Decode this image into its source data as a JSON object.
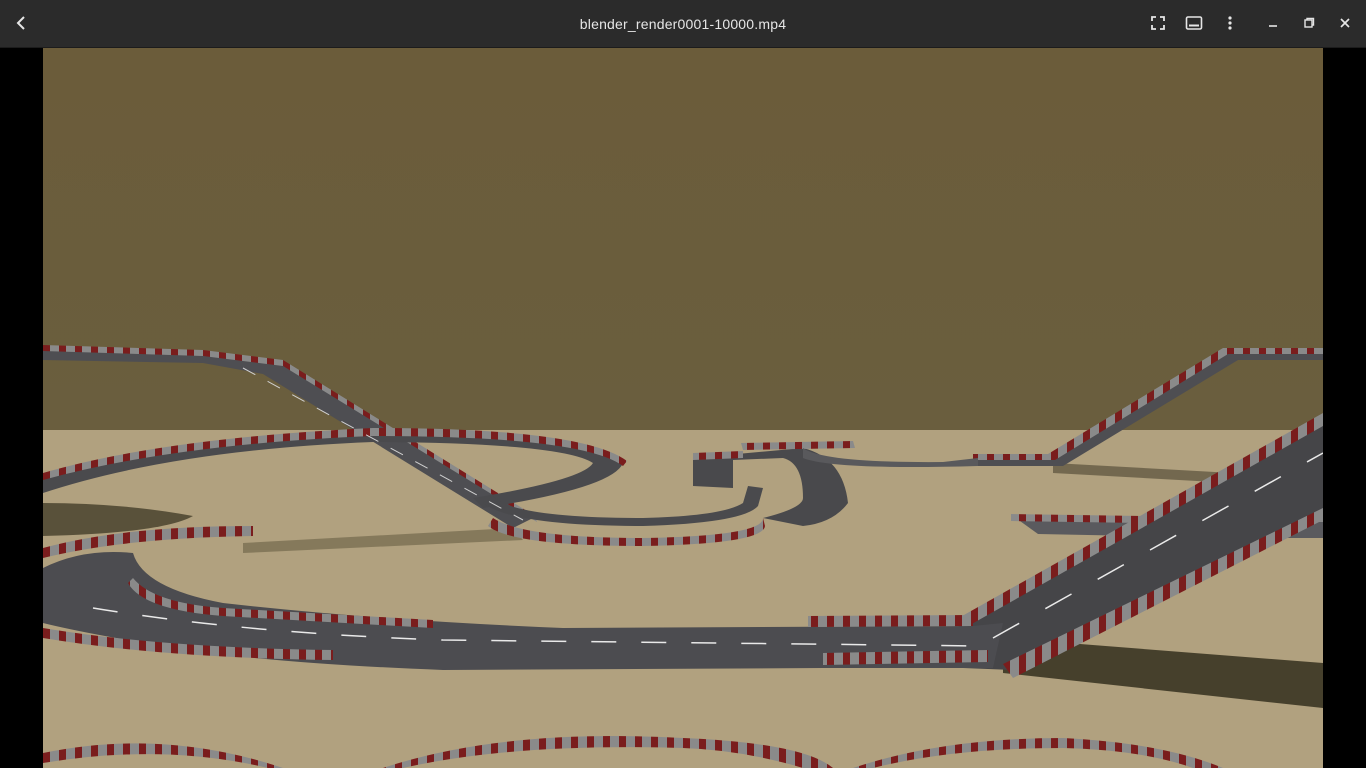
{
  "window": {
    "title": "blender_render0001-10000.mp4"
  },
  "icons": {
    "back": "back-arrow-icon",
    "fullscreen": "fullscreen-icon",
    "subtitles": "subtitles-icon",
    "menu": "kebab-menu-icon",
    "minimize": "minimize-icon",
    "restore": "restore-icon",
    "close": "close-icon"
  },
  "colors": {
    "titlebar_bg": "#2b2b2b",
    "sky": "#6b5e3c",
    "ground": "#b0a07e",
    "track": "#4a4a4c",
    "barrier_red": "#7a1d1d"
  }
}
